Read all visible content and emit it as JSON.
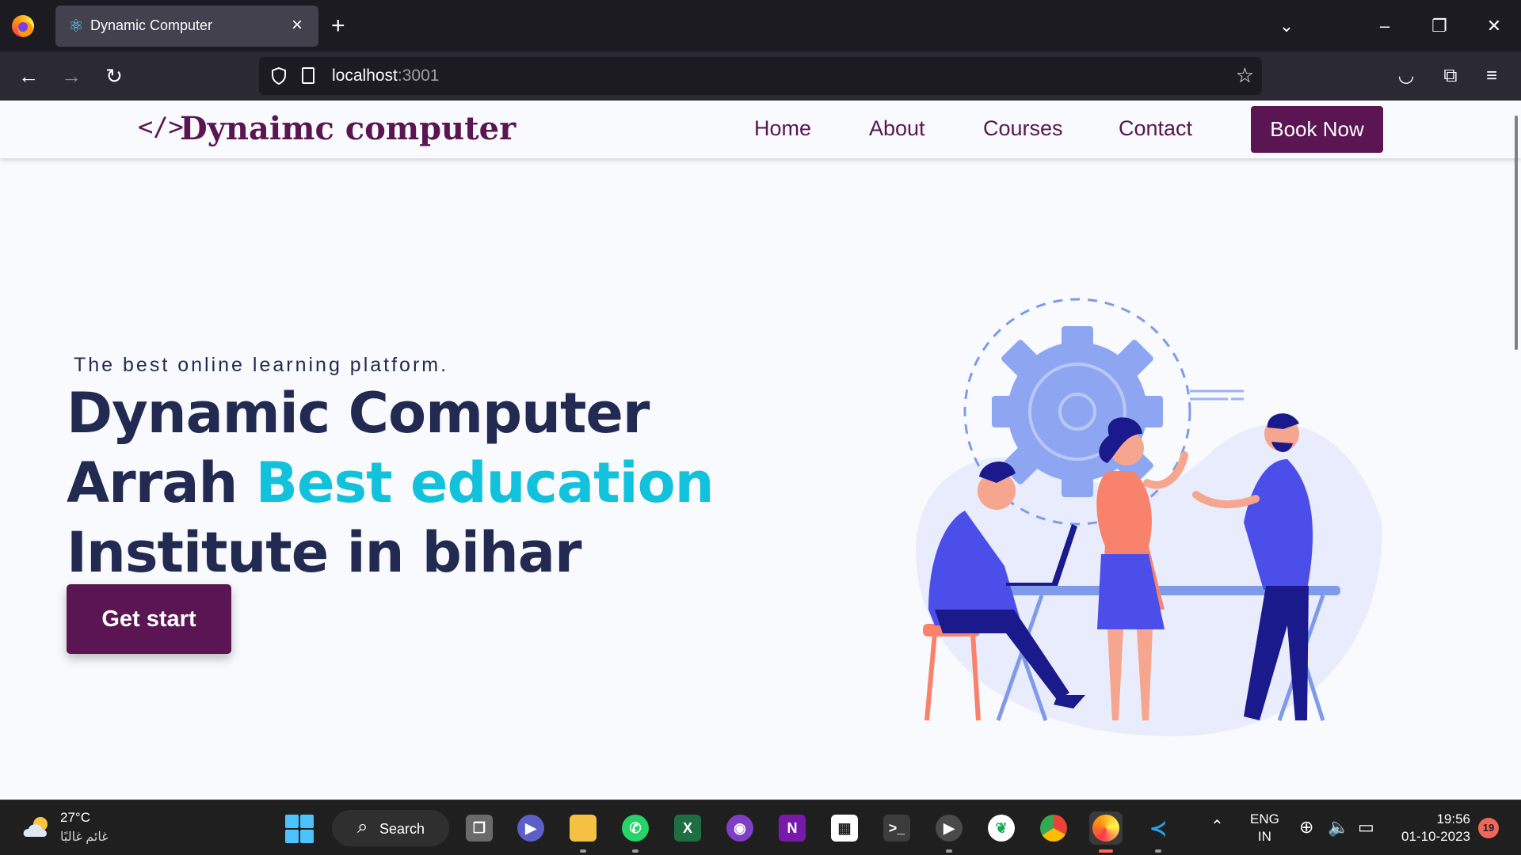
{
  "browser": {
    "tab_title": "Dynamic Computer",
    "url_host": "localhost",
    "url_port": ":3001"
  },
  "site": {
    "brand_icon": "</>",
    "brand_name": "Dynaimc computer",
    "nav": [
      "Home",
      "About",
      "Courses",
      "Contact"
    ],
    "book_now": "Book Now"
  },
  "hero": {
    "tagline": "The best online learning platform.",
    "line1": "Dynamic Computer",
    "line2_a": "Arrah ",
    "line2_b": "Best education",
    "line3": "Institute in bihar",
    "cta": "Get start",
    "accent_color": "#12c2dc",
    "brand_color": "#5a1552"
  },
  "taskbar": {
    "temperature": "27°C",
    "weather": "غائم غالبًا",
    "search_label": "Search",
    "language": "ENG",
    "region": "IN",
    "time": "19:56",
    "date": "01-10-2023",
    "notification_count": "19",
    "apps": [
      "task-view",
      "meet",
      "file-explorer",
      "whatsapp",
      "excel",
      "github-desktop",
      "onenote",
      "microsoft-store",
      "terminal",
      "media-player",
      "mongodb-compass",
      "chrome",
      "firefox",
      "vscode"
    ]
  }
}
